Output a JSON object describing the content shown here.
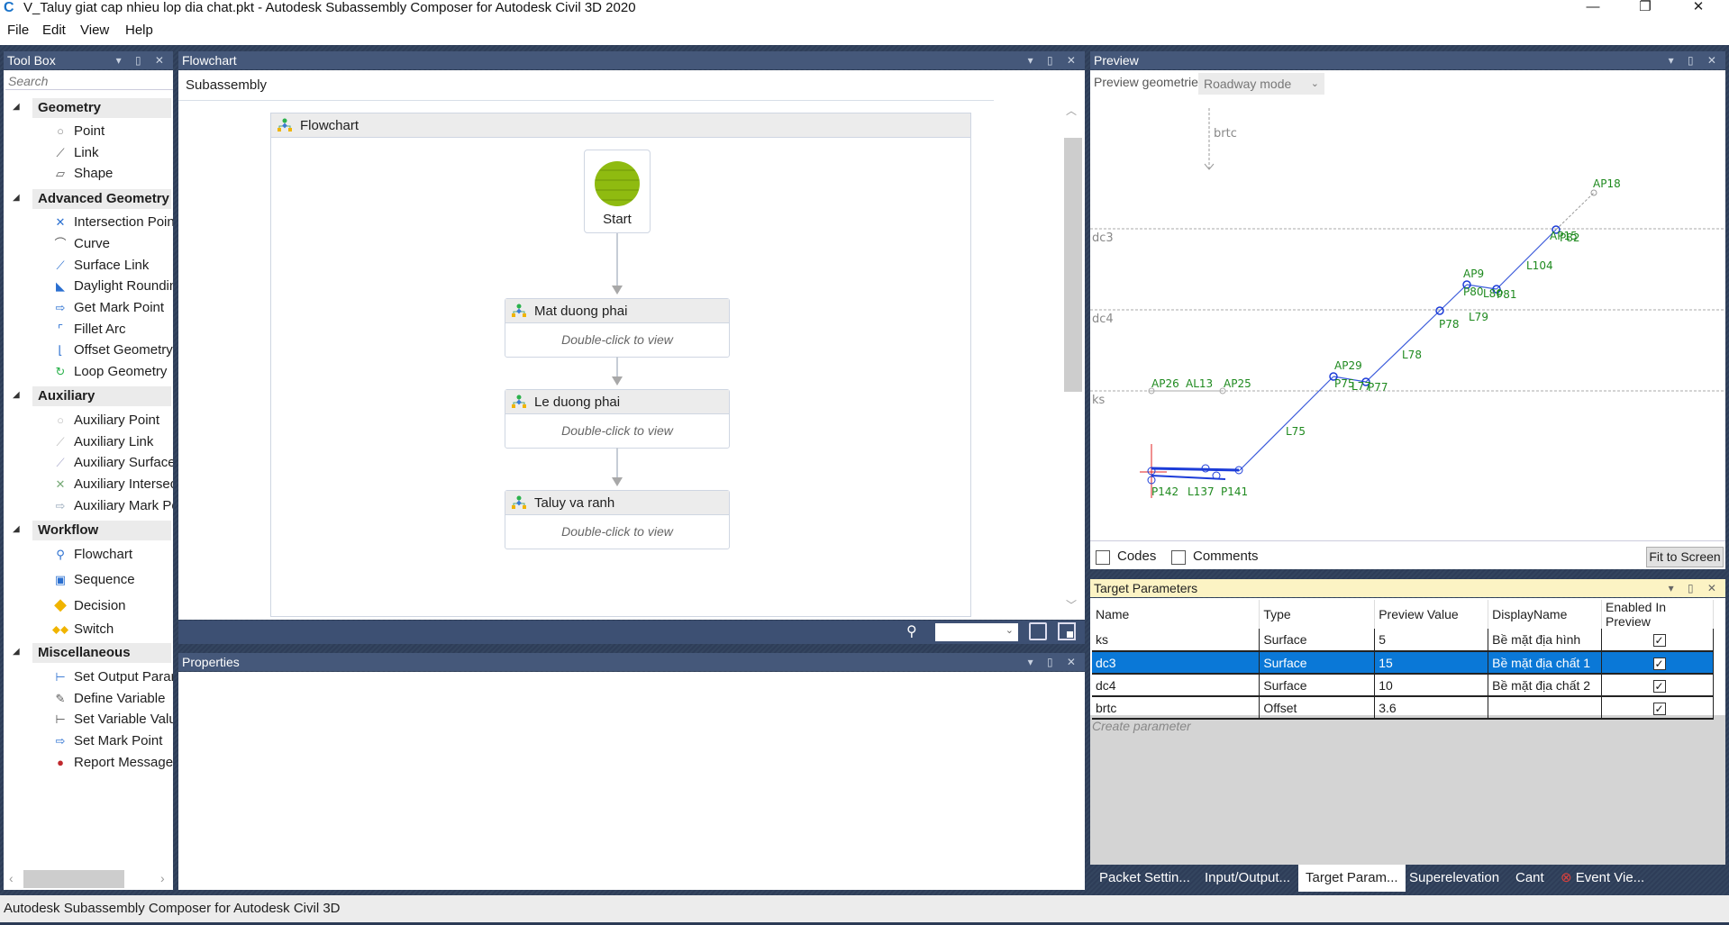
{
  "window": {
    "title": "V_Taluy giat cap nhieu lop dia chat.pkt - Autodesk Subassembly Composer for Autodesk Civil 3D 2020",
    "app_icon": "C",
    "controls": {
      "minimize": "—",
      "restore": "❐",
      "close": "✕"
    }
  },
  "menu": [
    "File",
    "Edit",
    "View",
    "Help"
  ],
  "toolbox": {
    "title": "Tool Box",
    "search_placeholder": "Search",
    "categories": [
      {
        "label": "Geometry",
        "items": [
          "Point",
          "Link",
          "Shape"
        ]
      },
      {
        "label": "Advanced Geometry",
        "items": [
          "Intersection Point",
          "Curve",
          "Surface Link",
          "Daylight Rounding",
          "Get Mark Point",
          "Fillet Arc",
          "Offset Geometry",
          "Loop Geometry"
        ]
      },
      {
        "label": "Auxiliary",
        "items": [
          "Auxiliary Point",
          "Auxiliary Link",
          "Auxiliary Surface",
          "Auxiliary Intersection",
          "Auxiliary Mark Point"
        ]
      },
      {
        "label": "Workflow",
        "items": [
          "Flowchart",
          "Sequence",
          "Decision",
          "Switch"
        ]
      },
      {
        "label": "Miscellaneous",
        "items": [
          "Set Output Parameter",
          "Define Variable",
          "Set Variable Value",
          "Set Mark Point",
          "Report Message"
        ]
      }
    ]
  },
  "flowchart_panel": {
    "title": "Flowchart",
    "breadcrumb": "Subassembly",
    "container_title": "Flowchart",
    "start_label": "Start",
    "nodes": [
      {
        "title": "Mat duong phai",
        "hint": "Double-click to view"
      },
      {
        "title": "Le duong phai",
        "hint": "Double-click to view"
      },
      {
        "title": "Taluy va ranh",
        "hint": "Double-click to view"
      }
    ],
    "zoom_value": ""
  },
  "properties_panel": {
    "title": "Properties"
  },
  "preview_panel": {
    "title": "Preview",
    "mode_label": "Preview geometries in",
    "mode_value": "Roadway mode",
    "offset_label": "brtc",
    "surfaces": [
      "dc3",
      "dc4",
      "ks"
    ],
    "labels": [
      "AP18",
      "AP15",
      "P82",
      "L104",
      "AP9",
      "P80",
      "L80",
      "P81",
      "L79",
      "P78",
      "L78",
      "AP29",
      "P75",
      "L77",
      "P77",
      "L75",
      "AP26",
      "AL13",
      "AP25",
      "P142",
      "L137",
      "P141"
    ],
    "codes_label": "Codes",
    "comments_label": "Comments",
    "codes_checked": false,
    "comments_checked": false,
    "fit_button": "Fit to Screen"
  },
  "target_parameters": {
    "title": "Target Parameters",
    "columns": [
      "Name",
      "Type",
      "Preview Value",
      "DisplayName",
      "Enabled In Preview"
    ],
    "rows": [
      {
        "name": "ks",
        "type": "Surface",
        "value": "5",
        "display": "Bề mặt địa hình",
        "enabled": true,
        "selected": false
      },
      {
        "name": "dc3",
        "type": "Surface",
        "value": "15",
        "display": "Bề mặt địa chất 1",
        "enabled": true,
        "selected": true
      },
      {
        "name": "dc4",
        "type": "Surface",
        "value": "10",
        "display": "Bề mặt địa chất 2",
        "enabled": true,
        "selected": false
      },
      {
        "name": "brtc",
        "type": "Offset",
        "value": "3.6",
        "display": "",
        "enabled": true,
        "selected": false
      }
    ],
    "create_placeholder": "Create parameter"
  },
  "bottom_tabs": [
    "Packet Settin...",
    "Input/Output...",
    "Target Param...",
    "Superelevation",
    "Cant",
    "Event Vie..."
  ],
  "active_tab": "Target Param...",
  "status_bar": "Autodesk Subassembly Composer for Autodesk Civil 3D",
  "colors": {
    "accent": "#0a78d7",
    "panel_header": "#45587a",
    "active_header": "#fcf3c4",
    "geometry_label": "#1f8a1f",
    "geometry_line": "#3b5bdb"
  }
}
